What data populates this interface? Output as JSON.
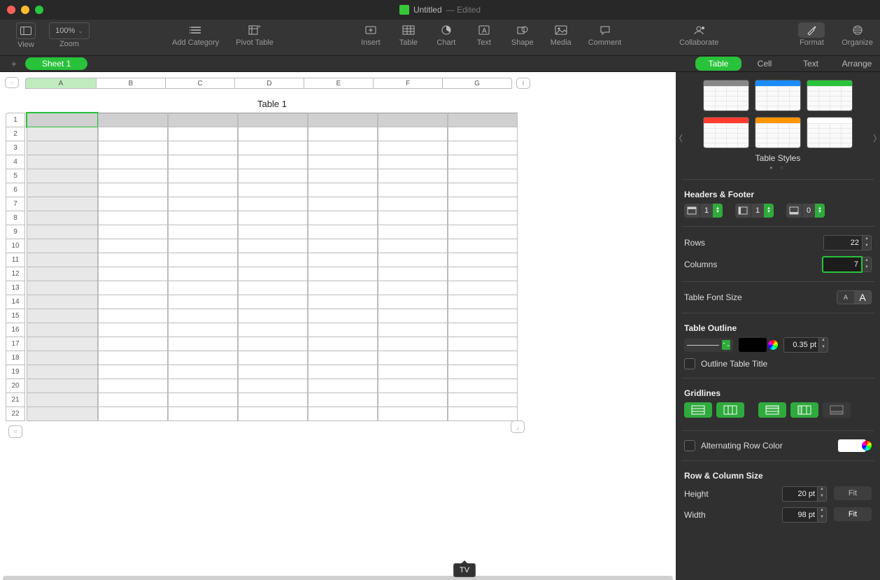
{
  "window": {
    "title": "Untitled",
    "edited": "— Edited"
  },
  "toolbar": {
    "view": "View",
    "zoom_level": "100%",
    "zoom": "Zoom",
    "add_category": "Add Category",
    "pivot": "Pivot Table",
    "insert": "Insert",
    "table": "Table",
    "chart": "Chart",
    "text": "Text",
    "shape": "Shape",
    "media": "Media",
    "comment": "Comment",
    "collaborate": "Collaborate",
    "format": "Format",
    "organize": "Organize"
  },
  "sheet": {
    "add": "+",
    "tab": "Sheet 1"
  },
  "inspector_tabs": {
    "table": "Table",
    "cell": "Cell",
    "text": "Text",
    "arrange": "Arrange"
  },
  "spreadsheet": {
    "title": "Table 1",
    "columns": [
      "A",
      "B",
      "C",
      "D",
      "E",
      "F",
      "G"
    ],
    "rows": [
      "1",
      "2",
      "3",
      "4",
      "5",
      "6",
      "7",
      "8",
      "9",
      "10",
      "11",
      "12",
      "13",
      "14",
      "15",
      "16",
      "17",
      "18",
      "19",
      "20",
      "21",
      "22"
    ],
    "selected_cell": "A1",
    "tooltip": "TV"
  },
  "insp": {
    "styles_label": "Table Styles",
    "headers_footer": "Headers & Footer",
    "hf": {
      "header_rows": "1",
      "header_cols": "1",
      "footer_rows": "0"
    },
    "rows_label": "Rows",
    "rows": "22",
    "columns_label": "Columns",
    "columns": "7",
    "font_size": "Table Font Size",
    "outline": "Table Outline",
    "outline_pt": "0.35 pt",
    "outline_title": "Outline Table Title",
    "gridlines": "Gridlines",
    "alt_row": "Alternating Row Color",
    "rowcol_size": "Row & Column Size",
    "height": "Height",
    "height_val": "20 pt",
    "width": "Width",
    "width_val": "98 pt",
    "fit": "Fit"
  }
}
